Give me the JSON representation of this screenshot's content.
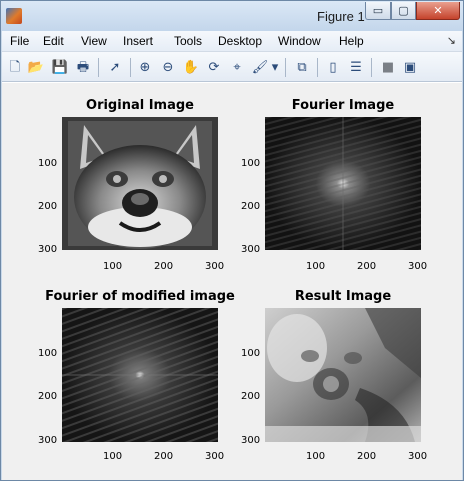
{
  "window": {
    "title": "Figure 1",
    "controls": {
      "minimize": "▭",
      "maximize": "▢",
      "close": "✕"
    }
  },
  "menu": {
    "items": [
      "File",
      "Edit",
      "View",
      "Insert",
      "Tools",
      "Desktop",
      "Window",
      "Help"
    ],
    "dock_glyph": "↘"
  },
  "toolbar": {
    "tools": [
      {
        "name": "new-figure-icon",
        "glyph": "🗋"
      },
      {
        "name": "open-file-icon",
        "glyph": "📂"
      },
      {
        "name": "save-icon",
        "glyph": "💾"
      },
      {
        "name": "print-icon",
        "glyph": "🖶"
      },
      {
        "name": "pointer-icon",
        "glyph": "➚"
      },
      {
        "name": "zoom-in-icon",
        "glyph": "⊕"
      },
      {
        "name": "zoom-out-icon",
        "glyph": "⊖"
      },
      {
        "name": "pan-hand-icon",
        "glyph": "✋"
      },
      {
        "name": "rotate-3d-icon",
        "glyph": "⟳"
      },
      {
        "name": "data-cursor-icon",
        "glyph": "⌖"
      },
      {
        "name": "brush-icon",
        "glyph": "🖌"
      },
      {
        "name": "brush-dropdown-icon",
        "glyph": "▾"
      },
      {
        "name": "link-plot-icon",
        "glyph": "⧉"
      },
      {
        "name": "colorbar-icon",
        "glyph": "▯"
      },
      {
        "name": "legend-icon",
        "glyph": "☰"
      },
      {
        "name": "hide-plot-tools-icon",
        "glyph": "■"
      },
      {
        "name": "show-plot-tools-icon",
        "glyph": "▣"
      }
    ]
  },
  "plots": [
    {
      "title": "Original Image",
      "yticks": [
        "100",
        "200",
        "300"
      ],
      "xticks": [
        "100",
        "200",
        "300"
      ],
      "image": "dog-photo"
    },
    {
      "title": "Fourier Image",
      "yticks": [
        "100",
        "200",
        "300"
      ],
      "xticks": [
        "100",
        "200",
        "300"
      ],
      "image": "fourier-spectrum"
    },
    {
      "title": "Fourier of modified image",
      "yticks": [
        "100",
        "200",
        "300"
      ],
      "xticks": [
        "100",
        "200",
        "300"
      ],
      "image": "fourier-spectrum-modified"
    },
    {
      "title": "Result Image",
      "yticks": [
        "100",
        "200",
        "300"
      ],
      "xticks": [
        "100",
        "200",
        "300"
      ],
      "image": "result-photo"
    }
  ]
}
